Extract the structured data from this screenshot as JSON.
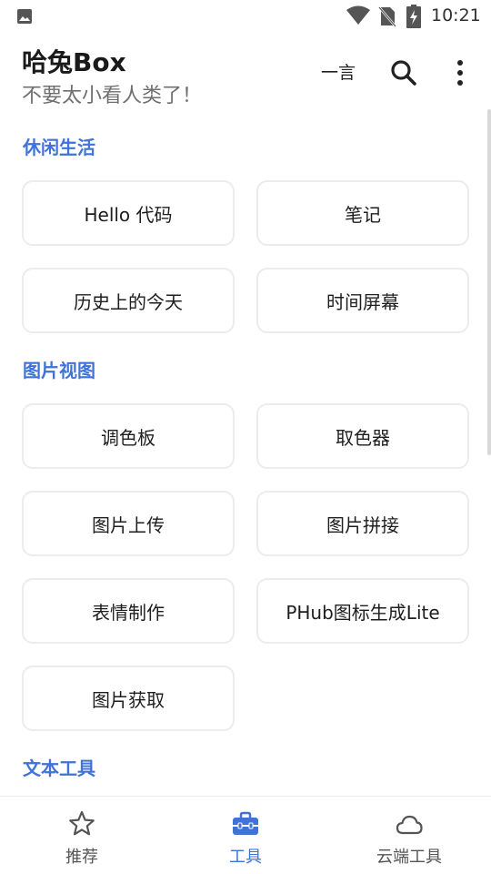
{
  "status_bar": {
    "time": "10:21"
  },
  "app_bar": {
    "title": "哈兔Box",
    "subtitle": "不要太小看人类了！",
    "yiyan_label": "一言"
  },
  "colors": {
    "accent": "#3f73d6",
    "text": "#1e1e1e",
    "subtitle": "#6f6f6f",
    "card_border": "#ececec"
  },
  "sections": [
    {
      "title": "休闲生活",
      "tools": [
        "Hello 代码",
        "笔记",
        "历史上的今天",
        "时间屏幕"
      ]
    },
    {
      "title": "图片视图",
      "tools": [
        "调色板",
        "取色器",
        "图片上传",
        "图片拼接",
        "表情制作",
        "PHub图标生成Lite",
        "图片获取"
      ]
    },
    {
      "title": "文本工具",
      "tools": []
    }
  ],
  "bottom_nav": [
    {
      "label": "推荐",
      "icon": "star-icon",
      "active": false
    },
    {
      "label": "工具",
      "icon": "toolbox-icon",
      "active": true
    },
    {
      "label": "云端工具",
      "icon": "cloud-icon",
      "active": false
    }
  ]
}
